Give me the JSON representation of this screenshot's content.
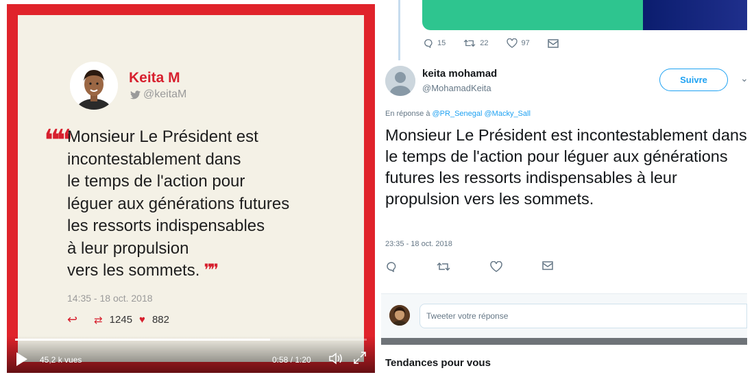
{
  "video": {
    "author_name": "Keita M",
    "author_handle": "@keitaM",
    "quote_lines": [
      "Monsieur Le Président est",
      "incontestablement dans",
      "le temps de l'action pour",
      "léguer aux générations futures",
      "les ressorts indispensables",
      "à leur propulsion",
      "vers les sommets."
    ],
    "timestamp": "14:35 - 18 oct. 2018",
    "retweets": "1245",
    "likes": "882",
    "views": "45,2 k vues",
    "timecode": "0:58 / 1:20",
    "progress_fraction": 0.725,
    "accent_color": "#d7202e",
    "card_bg": "#f4f1e6"
  },
  "previous_tweet": {
    "replies": "15",
    "retweets": "22",
    "likes": "97"
  },
  "tweet": {
    "name": "keita mohamad",
    "handle": "@MohamadKeita",
    "follow_label": "Suivre",
    "reply_prefix": "En réponse à",
    "reply_mentions": "@PR_Senegal @Macky_Sall",
    "text": "Monsieur Le Président est incontestablement dans le temps de l'action pour léguer aux générations futures les ressorts indispensables à leur propulsion vers les sommets.",
    "time": "23:35 - 18 oct. 2018",
    "reply_placeholder": "Tweeter votre réponse",
    "link_color": "#1da1f2"
  },
  "sidebar": {
    "trends_heading": "Tendances pour vous"
  }
}
